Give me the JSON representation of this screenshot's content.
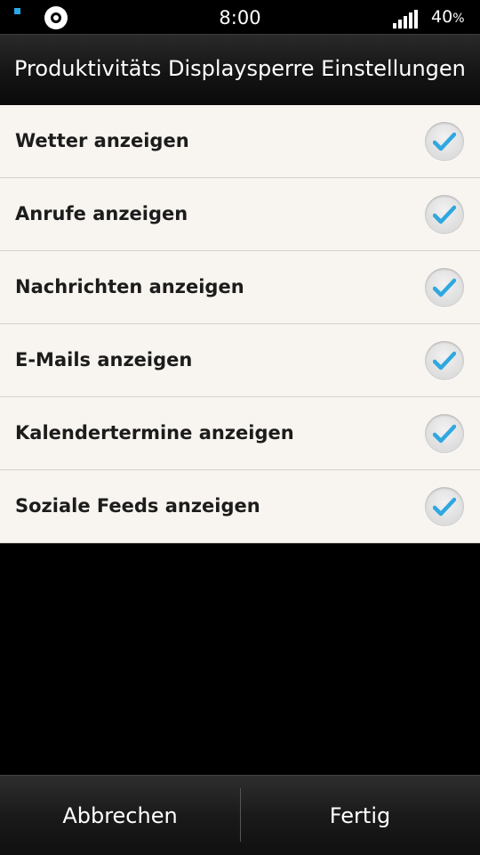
{
  "status_bar": {
    "time": "8:00",
    "battery_percent": "40",
    "battery_unit": "%",
    "notification_color": "#2aa9e6"
  },
  "header": {
    "title": "Produktivitäts Displaysperre Einstellungen"
  },
  "settings": [
    {
      "label": "Wetter anzeigen",
      "checked": true
    },
    {
      "label": "Anrufe anzeigen",
      "checked": true
    },
    {
      "label": "Nachrichten anzeigen",
      "checked": true
    },
    {
      "label": "E-Mails anzeigen",
      "checked": true
    },
    {
      "label": "Kalendertermine anzeigen",
      "checked": true
    },
    {
      "label": "Soziale Feeds anzeigen",
      "checked": true
    }
  ],
  "footer": {
    "cancel_label": "Abbrechen",
    "done_label": "Fertig"
  },
  "colors": {
    "check_accent": "#2fa8e0",
    "list_background": "#f8f4ef"
  }
}
